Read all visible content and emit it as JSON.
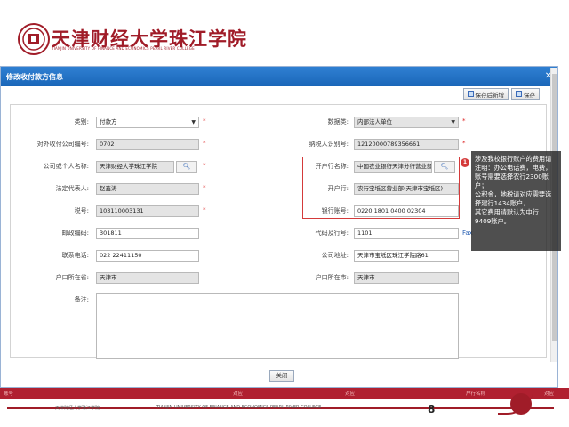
{
  "header": {
    "logo_text": "天津财经大学珠江学院",
    "logo_sub": "TIANJIN UNIVERSITY OF FINANCE AND ECONOMICS PEARL RIVER COLLEGE"
  },
  "modal": {
    "title": "修改收付款方信息",
    "toolbar": {
      "save_add_label": "保存后新增",
      "save_label": "保存"
    },
    "close_label": "关闭"
  },
  "form": {
    "category": {
      "label": "类别:",
      "value": "付款方"
    },
    "unit_code": {
      "label": "对外收付公司编号:",
      "value": "0702"
    },
    "company_name": {
      "label": "公司或个人名称:",
      "value": "天津财经大学珠江学院"
    },
    "legal_rep": {
      "label": "法定代表人:",
      "value": "赵鑫涛"
    },
    "tax_no": {
      "label": "税号:",
      "value": "103110003131"
    },
    "postcode": {
      "label": "邮政编码:",
      "value": "301811"
    },
    "phone": {
      "label": "联系电话:",
      "value": "022 22411150"
    },
    "province": {
      "label": "户口所在省:",
      "value": "天津市"
    },
    "data_type": {
      "label": "数据类:",
      "value": "内部法人单位"
    },
    "taxpayer_id": {
      "label": "纳税人识别号:",
      "value": "12120000789356661"
    },
    "bank_name": {
      "label": "开户行名称:",
      "value": "中国农业银行天津分行营业部"
    },
    "bank_branch": {
      "label": "开户行:",
      "value": "农行宝坻区营业部(天津市宝坻区)"
    },
    "bank_account": {
      "label": "银行账号:",
      "value": "0220 1801 0400 02304"
    },
    "bank_code": {
      "label": "代码及行号:",
      "value": "1101"
    },
    "address": {
      "label": "公司地址:",
      "value": "天津市宝坻区珠江学院路61"
    },
    "city": {
      "label": "户口所在市:",
      "value": "天津市"
    },
    "remark": {
      "label": "备注:"
    },
    "side_note": "Fax"
  },
  "callout": {
    "number": "1",
    "lines": [
      "涉及我校银行账户的费用请",
      "注明：办公电话费，电费，",
      "账号需要选择农行2300账",
      "户；",
      "公积金，地税请对应需要选",
      "择建行1434账户，",
      "其它费用请默认为中行",
      "9409账户。"
    ]
  },
  "background_table": {
    "col1": "账号",
    "col2": "对应",
    "col3": "对应",
    "col4": "户行名称",
    "col5": "对应"
  },
  "footer": {
    "left": "天津财经大学珠江学院",
    "mid": "TIANJIN UNIVERSITY OF FINANCE AND ECONOMICS PEARL RIVER COLLEGE",
    "page": "8"
  }
}
